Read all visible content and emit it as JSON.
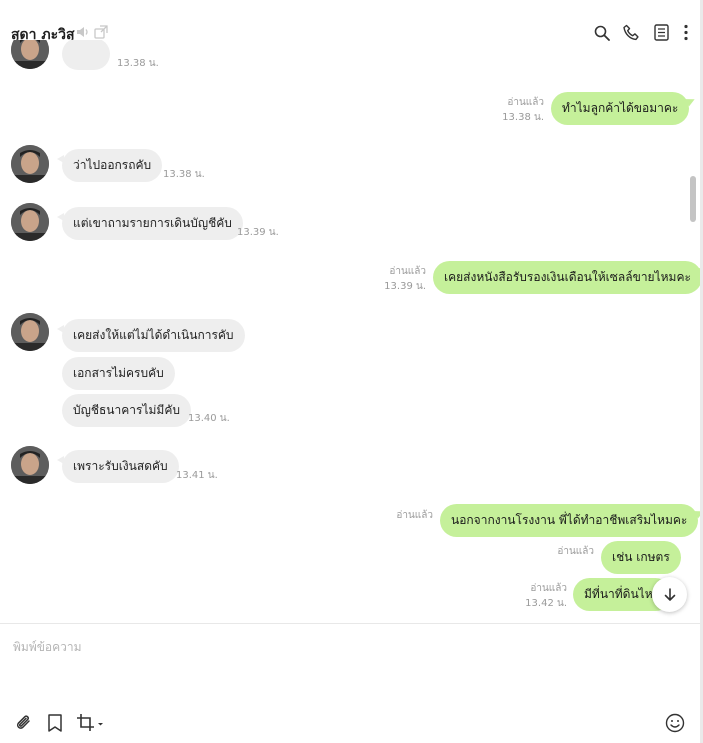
{
  "header": {
    "title": "สุดา ภะวิสุ",
    "icons": [
      "mute-icon",
      "external-window-icon",
      "search-icon",
      "phone-icon",
      "notes-icon",
      "more-icon"
    ]
  },
  "messages": [
    {
      "dir": "in",
      "text": "",
      "time": "13.38 น."
    },
    {
      "dir": "out",
      "text": "ทำไมลูกค้าได้ขอมาคะ",
      "read": "อ่านแล้ว",
      "time": "13.38 น."
    },
    {
      "dir": "in",
      "text": "ว่าไปออกรถคับ",
      "time": "13.38 น."
    },
    {
      "dir": "in",
      "text": "แต่เขาถามรายการเดินบัญชีคับ",
      "time": "13.39 น."
    },
    {
      "dir": "out",
      "text": "เคยส่งหนังสือรับรองเงินเดือนให้เซลล์ขายไหมคะ",
      "read": "อ่านแล้ว",
      "time": "13.39 น."
    },
    {
      "dir": "in",
      "text": "เคยส่งให้แต่ไม่ได้ดำเนินการคับ"
    },
    {
      "dir": "in",
      "text": "เอกสารไม่ครบคับ"
    },
    {
      "dir": "in",
      "text": "บัญชีธนาคารไม่มีคับ",
      "time": "13.40 น."
    },
    {
      "dir": "in",
      "text": "เพราะรับเงินสดคับ",
      "time": "13.41 น."
    },
    {
      "dir": "out",
      "text": "นอกจากงานโรงงาน พี่ได้ทำอาชีพเสริมไหมคะ",
      "read": "อ่านแล้ว"
    },
    {
      "dir": "out",
      "text": "เช่น เกษตร",
      "read": "อ่านแล้ว"
    },
    {
      "dir": "out",
      "text": "มีที่นาที่ดินไหม",
      "read": "อ่านแล้ว",
      "time": "13.42 น."
    }
  ],
  "composer": {
    "placeholder": "พิมพ์ข้อความ",
    "icons": [
      "attach-icon",
      "bookmark-icon",
      "crop-icon",
      "emoji-icon"
    ]
  },
  "scroll_to_bottom": "scroll-down-icon"
}
